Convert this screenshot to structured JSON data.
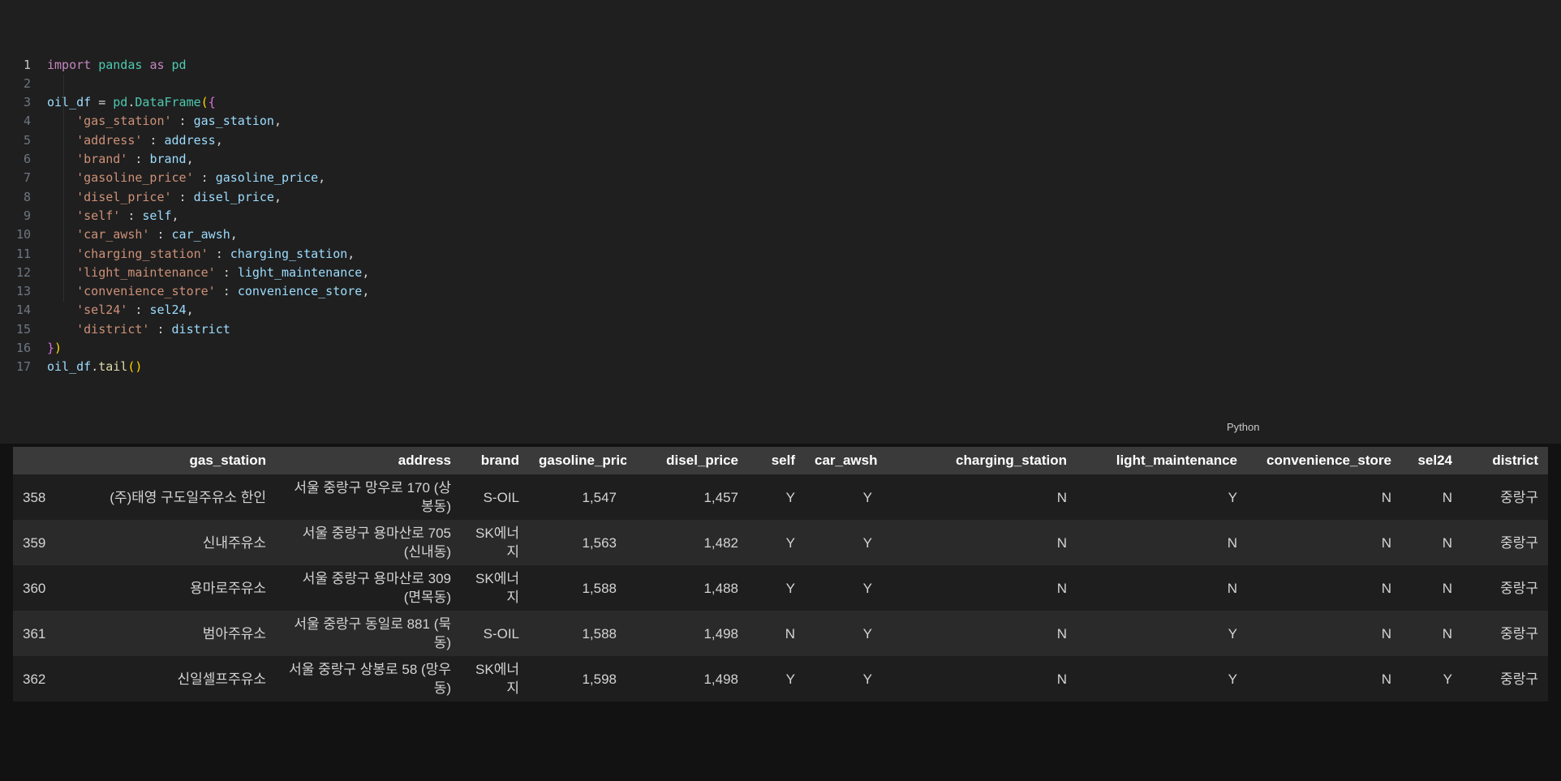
{
  "editor": {
    "language_label": "Python",
    "token_colors": {
      "kw": "#C586C0",
      "mod": "#4EC9B0",
      "var": "#9CDCFE",
      "str": "#CE9178",
      "pl": "#D4D4D4",
      "fn": "#DCDCAA",
      "b1": "#FFD700",
      "b2": "#DA70D6"
    },
    "lines": [
      {
        "num": "1",
        "tokens": [
          [
            "kw",
            "import"
          ],
          [
            "pl",
            " "
          ],
          [
            "mod",
            "pandas"
          ],
          [
            "pl",
            " "
          ],
          [
            "kw",
            "as"
          ],
          [
            "pl",
            " "
          ],
          [
            "mod",
            "pd"
          ]
        ]
      },
      {
        "num": "2",
        "tokens": []
      },
      {
        "num": "3",
        "tokens": [
          [
            "var",
            "oil_df"
          ],
          [
            "pl",
            " = "
          ],
          [
            "mod",
            "pd"
          ],
          [
            "pl",
            "."
          ],
          [
            "mod",
            "DataFrame"
          ],
          [
            "b1",
            "("
          ],
          [
            "b2",
            "{"
          ]
        ]
      },
      {
        "num": "4",
        "tokens": [
          [
            "pl",
            "    "
          ],
          [
            "str",
            "'gas_station'"
          ],
          [
            "pl",
            " : "
          ],
          [
            "var",
            "gas_station"
          ],
          [
            "pl",
            ","
          ]
        ]
      },
      {
        "num": "5",
        "tokens": [
          [
            "pl",
            "    "
          ],
          [
            "str",
            "'address'"
          ],
          [
            "pl",
            " : "
          ],
          [
            "var",
            "address"
          ],
          [
            "pl",
            ","
          ]
        ]
      },
      {
        "num": "6",
        "tokens": [
          [
            "pl",
            "    "
          ],
          [
            "str",
            "'brand'"
          ],
          [
            "pl",
            " : "
          ],
          [
            "var",
            "brand"
          ],
          [
            "pl",
            ","
          ]
        ]
      },
      {
        "num": "7",
        "tokens": [
          [
            "pl",
            "    "
          ],
          [
            "str",
            "'gasoline_price'"
          ],
          [
            "pl",
            " : "
          ],
          [
            "var",
            "gasoline_price"
          ],
          [
            "pl",
            ","
          ]
        ]
      },
      {
        "num": "8",
        "tokens": [
          [
            "pl",
            "    "
          ],
          [
            "str",
            "'disel_price'"
          ],
          [
            "pl",
            " : "
          ],
          [
            "var",
            "disel_price"
          ],
          [
            "pl",
            ","
          ]
        ]
      },
      {
        "num": "9",
        "tokens": [
          [
            "pl",
            "    "
          ],
          [
            "str",
            "'self'"
          ],
          [
            "pl",
            " : "
          ],
          [
            "var",
            "self"
          ],
          [
            "pl",
            ","
          ]
        ]
      },
      {
        "num": "10",
        "tokens": [
          [
            "pl",
            "    "
          ],
          [
            "str",
            "'car_awsh'"
          ],
          [
            "pl",
            " : "
          ],
          [
            "var",
            "car_awsh"
          ],
          [
            "pl",
            ","
          ]
        ]
      },
      {
        "num": "11",
        "tokens": [
          [
            "pl",
            "    "
          ],
          [
            "str",
            "'charging_station'"
          ],
          [
            "pl",
            " : "
          ],
          [
            "var",
            "charging_station"
          ],
          [
            "pl",
            ","
          ]
        ]
      },
      {
        "num": "12",
        "tokens": [
          [
            "pl",
            "    "
          ],
          [
            "str",
            "'light_maintenance'"
          ],
          [
            "pl",
            " : "
          ],
          [
            "var",
            "light_maintenance"
          ],
          [
            "pl",
            ","
          ]
        ]
      },
      {
        "num": "13",
        "tokens": [
          [
            "pl",
            "    "
          ],
          [
            "str",
            "'convenience_store'"
          ],
          [
            "pl",
            " : "
          ],
          [
            "var",
            "convenience_store"
          ],
          [
            "pl",
            ","
          ]
        ]
      },
      {
        "num": "14",
        "tokens": [
          [
            "pl",
            "    "
          ],
          [
            "str",
            "'sel24'"
          ],
          [
            "pl",
            " : "
          ],
          [
            "var",
            "sel24"
          ],
          [
            "pl",
            ","
          ]
        ]
      },
      {
        "num": "15",
        "tokens": [
          [
            "pl",
            "    "
          ],
          [
            "str",
            "'district'"
          ],
          [
            "pl",
            " : "
          ],
          [
            "var",
            "district"
          ]
        ]
      },
      {
        "num": "16",
        "tokens": [
          [
            "b2",
            "}"
          ],
          [
            "b1",
            ")"
          ]
        ]
      },
      {
        "num": "17",
        "tokens": [
          [
            "var",
            "oil_df"
          ],
          [
            "pl",
            "."
          ],
          [
            "fn",
            "tail"
          ],
          [
            "b1",
            "("
          ],
          [
            "b1",
            ")"
          ]
        ]
      }
    ]
  },
  "table": {
    "columns": [
      {
        "key": "index",
        "label": ""
      },
      {
        "key": "gas_station",
        "label": "gas_station"
      },
      {
        "key": "address",
        "label": "address"
      },
      {
        "key": "brand",
        "label": "brand"
      },
      {
        "key": "gasoline_price",
        "label": "gasoline_price"
      },
      {
        "key": "disel_price",
        "label": "disel_price"
      },
      {
        "key": "self",
        "label": "self"
      },
      {
        "key": "car_awsh",
        "label": "car_awsh"
      },
      {
        "key": "charging_station",
        "label": "charging_station"
      },
      {
        "key": "light_maintenance",
        "label": "light_maintenance"
      },
      {
        "key": "convenience_store",
        "label": "convenience_store"
      },
      {
        "key": "sel24",
        "label": "sel24"
      },
      {
        "key": "district",
        "label": "district"
      }
    ],
    "rows": [
      {
        "index": "358",
        "gas_station": "(주)태영 구도일주유소 한인",
        "address": "서울 중랑구 망우로 170 (상봉동)",
        "brand": "S-OIL",
        "gasoline_price": "1,547",
        "disel_price": "1,457",
        "self": "Y",
        "car_awsh": "Y",
        "charging_station": "N",
        "light_maintenance": "Y",
        "convenience_store": "N",
        "sel24": "N",
        "district": "중랑구"
      },
      {
        "index": "359",
        "gas_station": "신내주유소",
        "address": "서울 중랑구 용마산로 705 (신내동)",
        "brand": "SK에너지",
        "gasoline_price": "1,563",
        "disel_price": "1,482",
        "self": "Y",
        "car_awsh": "Y",
        "charging_station": "N",
        "light_maintenance": "N",
        "convenience_store": "N",
        "sel24": "N",
        "district": "중랑구"
      },
      {
        "index": "360",
        "gas_station": "용마로주유소",
        "address": "서울 중랑구 용마산로 309 (면목동)",
        "brand": "SK에너지",
        "gasoline_price": "1,588",
        "disel_price": "1,488",
        "self": "Y",
        "car_awsh": "Y",
        "charging_station": "N",
        "light_maintenance": "N",
        "convenience_store": "N",
        "sel24": "N",
        "district": "중랑구"
      },
      {
        "index": "361",
        "gas_station": "범아주유소",
        "address": "서울 중랑구 동일로 881 (묵동)",
        "brand": "S-OIL",
        "gasoline_price": "1,588",
        "disel_price": "1,498",
        "self": "N",
        "car_awsh": "Y",
        "charging_station": "N",
        "light_maintenance": "Y",
        "convenience_store": "N",
        "sel24": "N",
        "district": "중랑구"
      },
      {
        "index": "362",
        "gas_station": "신일셀프주유소",
        "address": "서울 중랑구 상봉로 58 (망우동)",
        "brand": "SK에너지",
        "gasoline_price": "1,598",
        "disel_price": "1,498",
        "self": "Y",
        "car_awsh": "Y",
        "charging_station": "N",
        "light_maintenance": "Y",
        "convenience_store": "N",
        "sel24": "Y",
        "district": "중랑구"
      }
    ]
  }
}
